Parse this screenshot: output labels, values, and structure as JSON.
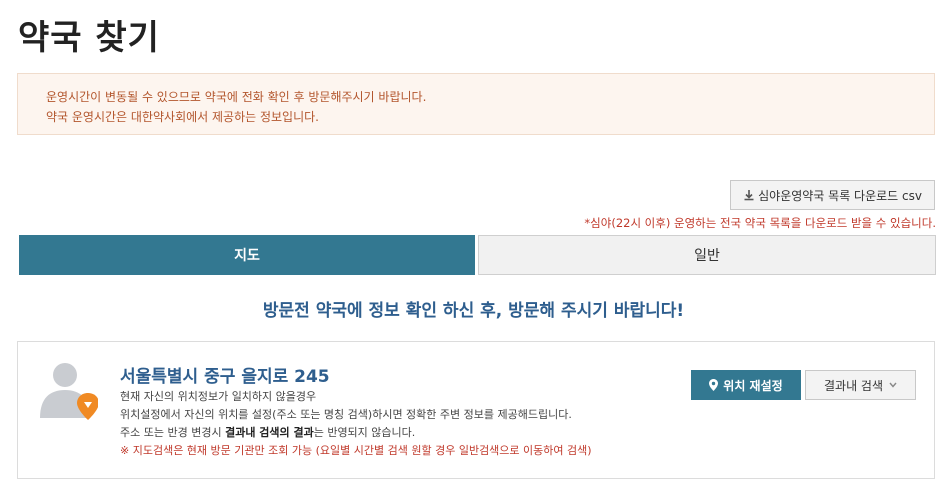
{
  "page": {
    "title": "약국 찾기"
  },
  "notice": {
    "line1": "운영시간이 변동될 수 있으므로 약국에 전화 확인 후 방문해주시기 바랍니다.",
    "line2": "약국 운영시간은 대한약사회에서 제공하는 정보입니다."
  },
  "download": {
    "button_label": "심야운영약국 목록 다운로드 csv",
    "icon": "download-icon",
    "note": "*심야(22시 이후) 운영하는 전국 약국 목록을 다운로드 받을 수 있습니다."
  },
  "tabs": [
    {
      "label": "지도",
      "active": true
    },
    {
      "label": "일반",
      "active": false
    }
  ],
  "visit_message": "방문전 약국에 정보 확인 하신 후, 방문해 주시기 바랍니다!",
  "location": {
    "address": "서울특별시 중구 을지로 245",
    "line1": "현재 자신의 위치정보가 일치하지 않을경우",
    "line2": "위치설정에서 자신의 위치를 설정(주소 또는 명칭 검색)하시면 정확한 주변 정보를 제공해드립니다.",
    "line3_pre": "주소 또는 반경 변경시 ",
    "line3_bold": "결과내 검색의 결과",
    "line3_post": "는 반영되지 않습니다.",
    "warning": "※ 지도검색은 현재 방문 기관만 조회 가능 (요일별 시간별 검색 원할 경우 일반검색으로 이동하여 검색)",
    "reset_button": "위치 재설정",
    "result_search_button": "결과내 검색"
  },
  "colors": {
    "accent": "#337891",
    "notice_text": "#b3562d",
    "notice_bg": "#fdf5ef",
    "warning": "#c0392b",
    "heading_blue": "#2e5e8e",
    "pin_orange": "#f08a24"
  }
}
